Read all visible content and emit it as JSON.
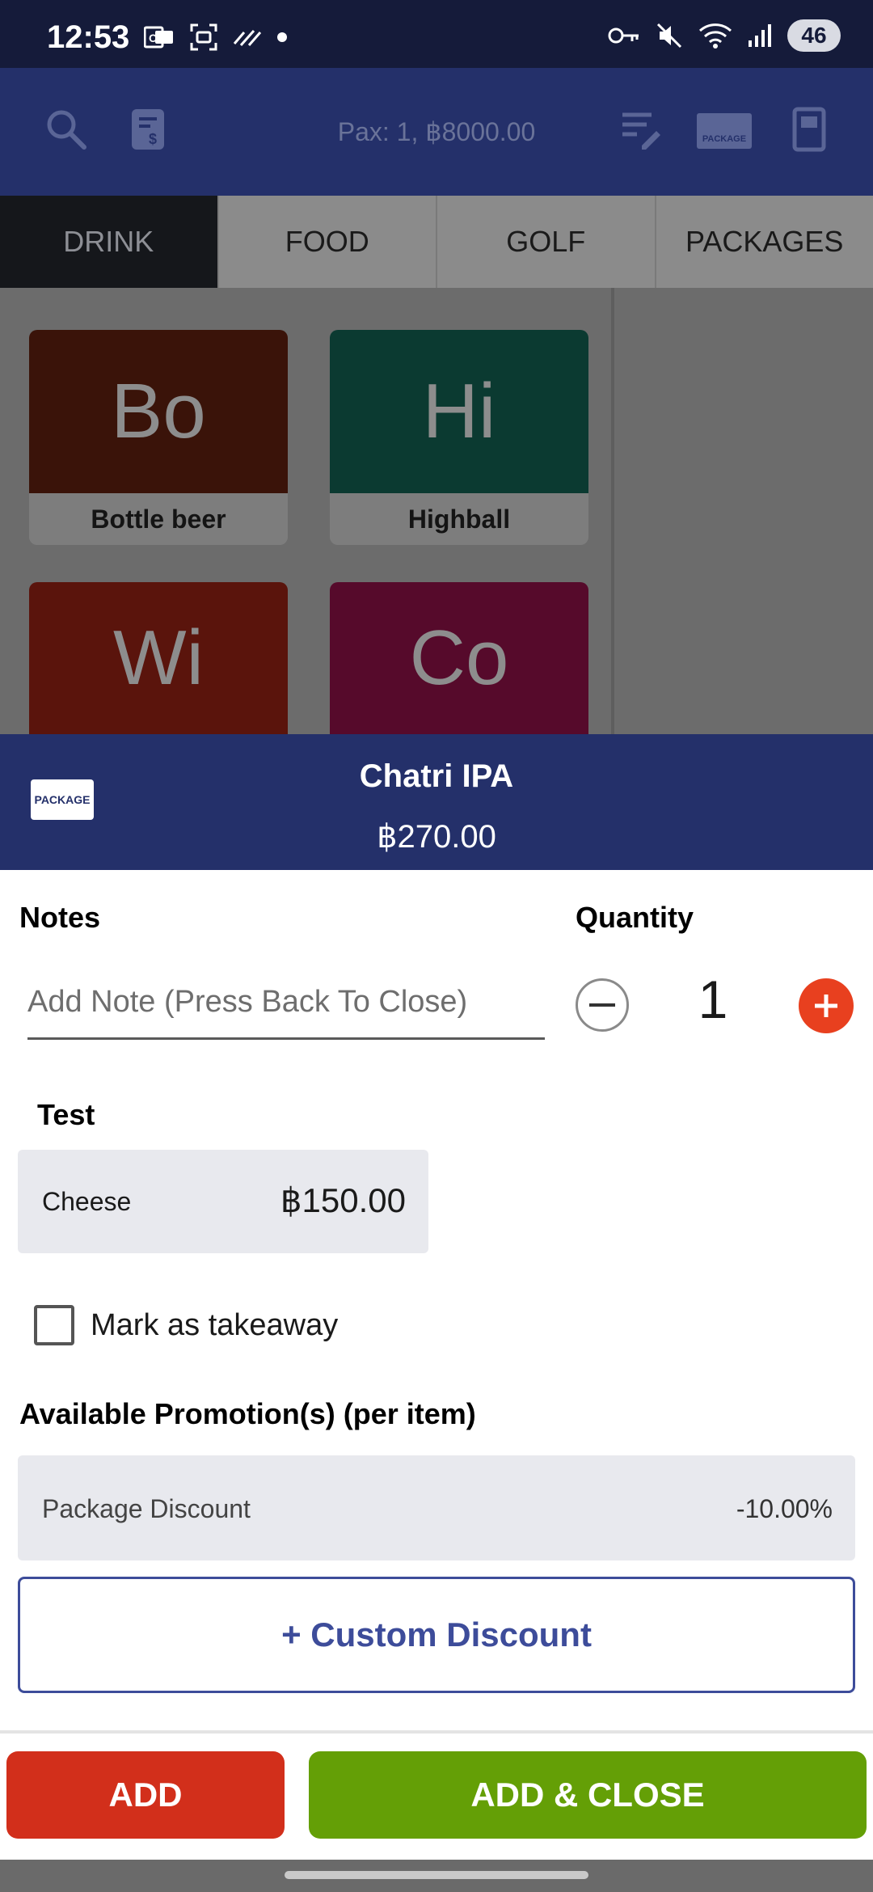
{
  "status_bar": {
    "time": "12:53",
    "battery": "46",
    "icons_left": [
      "outlook-icon",
      "screenshot-icon",
      "signal-pattern-icon",
      "dot-icon"
    ],
    "icons_right": [
      "key-icon",
      "mute-icon",
      "wifi-icon",
      "cell-signal-icon",
      "battery-icon"
    ]
  },
  "toolbar": {
    "pax_text": "Pax: 1, ฿8000.00",
    "package_badge": "PACKAGE"
  },
  "tabs": [
    {
      "label": "DRINK",
      "active": true
    },
    {
      "label": "FOOD",
      "active": false
    },
    {
      "label": "GOLF",
      "active": false
    },
    {
      "label": "PACKAGES",
      "active": false
    }
  ],
  "categories": [
    {
      "abbr": "Bo",
      "label": "Bottle beer",
      "color": "#3a1309"
    },
    {
      "abbr": "Hi",
      "label": "Highball",
      "color": "#0b3a31"
    },
    {
      "abbr": "Wi",
      "label": "",
      "color": "#5a140c"
    },
    {
      "abbr": "Co",
      "label": "",
      "color": "#560a2b"
    }
  ],
  "item": {
    "badge": "PACKAGE",
    "name": "Chatri IPA",
    "price": "฿270.00"
  },
  "notes": {
    "title": "Notes",
    "placeholder": "Add Note (Press Back To Close)"
  },
  "quantity": {
    "title": "Quantity",
    "value": "1"
  },
  "modifier_group": {
    "title": "Test",
    "options": [
      {
        "name": "Cheese",
        "price": "฿150.00"
      }
    ]
  },
  "takeaway": {
    "label": "Mark as takeaway",
    "checked": false
  },
  "promotions": {
    "title": "Available Promotion(s) (per item)",
    "items": [
      {
        "name": "Package Discount",
        "value": "-10.00%"
      }
    ],
    "custom_button": "+ Custom Discount"
  },
  "actions": {
    "add": "ADD",
    "add_close": "ADD & CLOSE"
  },
  "colors": {
    "header_bg": "#24306a",
    "add": "#d22f1b",
    "add_close": "#649f06",
    "plus": "#e8401f",
    "accent_text": "#3d4c9a"
  }
}
